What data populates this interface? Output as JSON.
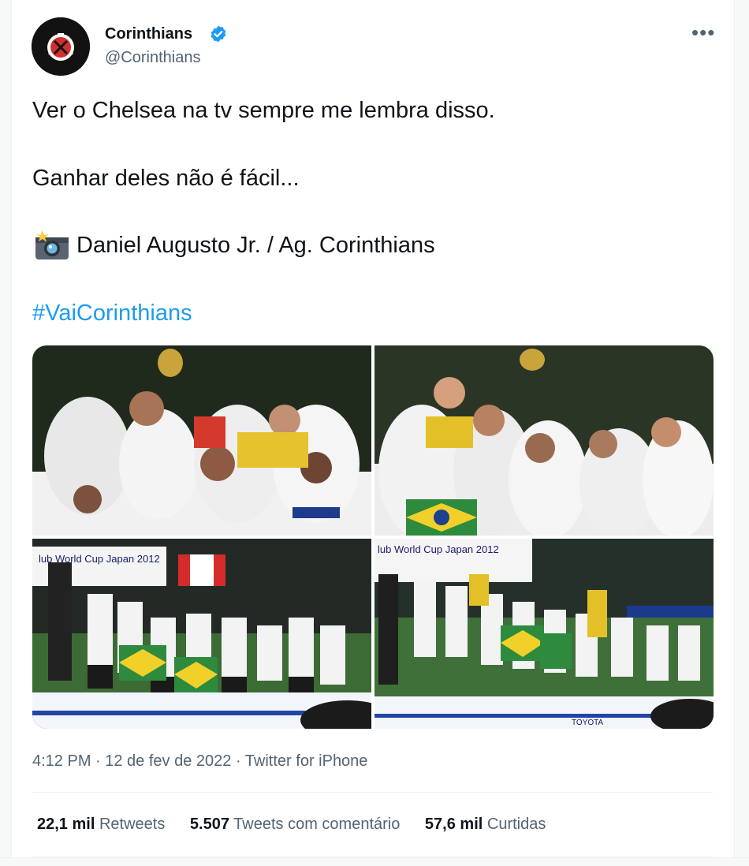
{
  "account": {
    "name": "Corinthians",
    "handle": "@Corinthians",
    "verified": true,
    "avatar_icon": "corinthians-crest-icon",
    "more_label": "•••"
  },
  "tweet": {
    "line1": "Ver o Chelsea na tv sempre me lembra disso.",
    "line2": "Ganhar deles não é fácil...",
    "photo_credit": "Daniel Augusto Jr. / Ag. Corinthians",
    "camera_icon": "camera-flash-icon",
    "hashtag": "#VaiCorinthians"
  },
  "media": [
    {
      "alt_name": "players-celebrating-with-trophy-1"
    },
    {
      "alt_name": "players-celebrating-with-trophy-2"
    },
    {
      "alt_name": "team-celebrating-on-podium-1",
      "caption_text": "lub World Cup Japan 2012"
    },
    {
      "alt_name": "team-celebrating-on-podium-2",
      "caption_text": "lub World Cup Japan 2012",
      "sponsor": "TOYOTA"
    }
  ],
  "meta": {
    "time": "4:12 PM",
    "date": "12 de fev de 2022",
    "source": "Twitter for iPhone",
    "full": "4:12 PM · 12 de fev de 2022 · Twitter for iPhone"
  },
  "stats": {
    "retweets_count": "22,1 mil",
    "retweets_label": "Retweets",
    "quotes_count": "5.507",
    "quotes_label": "Tweets com comentário",
    "likes_count": "57,6 mil",
    "likes_label": "Curtidas"
  },
  "colors": {
    "link": "#1d9bf0",
    "secondary_text": "#536471",
    "primary_text": "#0f1419",
    "verified": "#1d9bf0"
  }
}
